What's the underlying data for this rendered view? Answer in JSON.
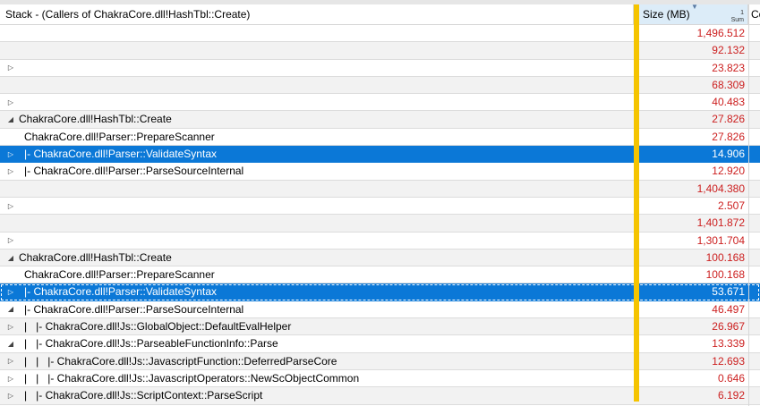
{
  "header": {
    "stack_col": "Stack - (Callers of ChakraCore.dll!HashTbl::Create)",
    "size_col": "Size (MB)",
    "sort_index": "1",
    "sum_label": "Sum",
    "next_col": "Co"
  },
  "rows": [
    {
      "expander": "",
      "label": "",
      "size": "1,496.512",
      "selected": false
    },
    {
      "expander": "",
      "label": "",
      "size": "92.132",
      "selected": false
    },
    {
      "expander": "▷",
      "label": "",
      "size": "23.823",
      "selected": false
    },
    {
      "expander": "",
      "label": "",
      "size": "68.309",
      "selected": false
    },
    {
      "expander": "▷",
      "label": "",
      "size": "40.483",
      "selected": false
    },
    {
      "expander": "◢",
      "label": "ChakraCore.dll!HashTbl::Create",
      "size": "27.826",
      "selected": false
    },
    {
      "expander": "",
      "label": "ChakraCore.dll!Parser::PrepareScanner",
      "size": "27.826",
      "selected": false
    },
    {
      "expander": "▷",
      "label": "|- ChakraCore.dll!Parser::ValidateSyntax",
      "size": "14.906",
      "selected": true
    },
    {
      "expander": "▷",
      "label": "|- ChakraCore.dll!Parser::ParseSourceInternal",
      "size": "12.920",
      "selected": false
    },
    {
      "expander": "",
      "label": "",
      "size": "1,404.380",
      "selected": false
    },
    {
      "expander": "▷",
      "label": "",
      "size": "2.507",
      "selected": false
    },
    {
      "expander": "",
      "label": "",
      "size": "1,401.872",
      "selected": false
    },
    {
      "expander": "▷",
      "label": "",
      "size": "1,301.704",
      "selected": false
    },
    {
      "expander": "◢",
      "label": "ChakraCore.dll!HashTbl::Create",
      "size": "100.168",
      "selected": false
    },
    {
      "expander": "",
      "label": "ChakraCore.dll!Parser::PrepareScanner",
      "size": "100.168",
      "selected": false
    },
    {
      "expander": "▷",
      "label": "|- ChakraCore.dll!Parser::ValidateSyntax",
      "size": "53.671",
      "selected": true
    },
    {
      "expander": "◢",
      "label": "|- ChakraCore.dll!Parser::ParseSourceInternal",
      "size": "46.497",
      "selected": false
    },
    {
      "expander": "▷",
      "label": "|   |- ChakraCore.dll!Js::GlobalObject::DefaultEvalHelper",
      "size": "26.967",
      "selected": false
    },
    {
      "expander": "◢",
      "label": "|   |- ChakraCore.dll!Js::ParseableFunctionInfo::Parse",
      "size": "13.339",
      "selected": false
    },
    {
      "expander": "▷",
      "label": "|   |   |- ChakraCore.dll!Js::JavascriptFunction::DeferredParseCore",
      "size": "12.693",
      "selected": false
    },
    {
      "expander": "▷",
      "label": "|   |   |- ChakraCore.dll!Js::JavascriptOperators::NewScObjectCommon",
      "size": "0.646",
      "selected": false
    },
    {
      "expander": "▷",
      "label": "|   |- ChakraCore.dll!Js::ScriptContext::ParseScript",
      "size": "6.192",
      "selected": false
    }
  ]
}
